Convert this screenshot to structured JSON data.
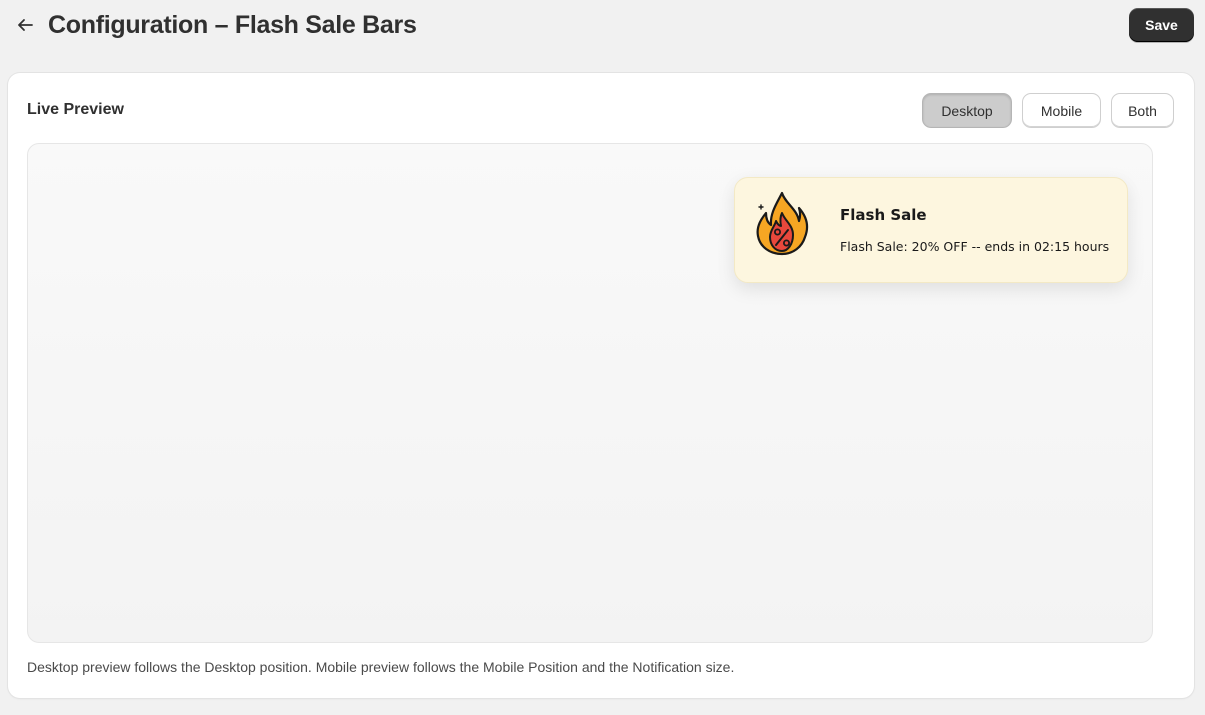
{
  "header": {
    "back_icon": "arrow-left-icon",
    "title": "Configuration – Flash Sale Bars",
    "save_label": "Save"
  },
  "preview": {
    "title": "Live Preview",
    "device_tabs": [
      {
        "label": "Desktop",
        "active": true
      },
      {
        "label": "Mobile",
        "active": false
      },
      {
        "label": "Both",
        "active": false
      }
    ],
    "notification": {
      "icon": "fire-percent-icon",
      "title": "Flash Sale",
      "message": "Flash Sale: 20% OFF -- ends in 02:15 hours",
      "background_color": "#fdf6df"
    },
    "footnote": "Desktop preview follows the Desktop position. Mobile preview follows the Mobile Position and the Notification size."
  },
  "colors": {
    "primary_button": "#303030",
    "active_tab": "#cccccc"
  }
}
